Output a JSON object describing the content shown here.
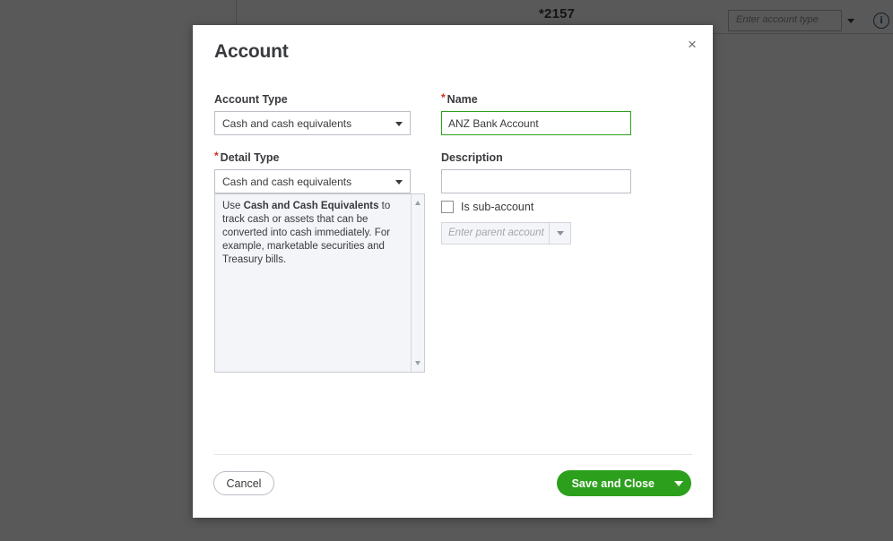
{
  "background": {
    "account_number": "*2157",
    "account_type_placeholder": "Enter account type",
    "info_icon": "info-icon",
    "dropdown_caret_icon": "chevron-down-icon"
  },
  "modal": {
    "title": "Account",
    "close_icon": "×",
    "account_type": {
      "label": "Account Type",
      "value": "Cash and cash equivalents",
      "required": false,
      "caret_icon": "chevron-down-icon"
    },
    "detail_type": {
      "label": "Detail Type",
      "value": "Cash and cash equivalents",
      "required": true,
      "required_marker": "*",
      "caret_icon": "chevron-down-icon"
    },
    "help": {
      "prefix": "Use ",
      "bold": "Cash and Cash Equivalents",
      "suffix": " to track cash or assets that can be converted into cash immediately. For example, marketable securities and Treasury bills.",
      "scroll_up_icon": "scroll-up-arrow-icon",
      "scroll_down_icon": "scroll-down-arrow-icon"
    },
    "name": {
      "label": "Name",
      "required": true,
      "required_marker": "*",
      "value": "ANZ Bank Account",
      "placeholder": ""
    },
    "description": {
      "label": "Description",
      "required": false,
      "value": "",
      "placeholder": ""
    },
    "sub_account": {
      "checkbox_label": "Is sub-account",
      "checked": false,
      "parent_placeholder": "Enter parent account",
      "parent_value": "",
      "disabled": true,
      "caret_icon": "chevron-down-icon"
    },
    "footer": {
      "cancel_label": "Cancel",
      "save_label": "Save and Close",
      "save_caret_icon": "chevron-down-icon"
    }
  },
  "colors": {
    "brand_green": "#2ca01c",
    "required_red": "#d52b1e",
    "text": "#393a3d",
    "overlay": "#595959"
  }
}
